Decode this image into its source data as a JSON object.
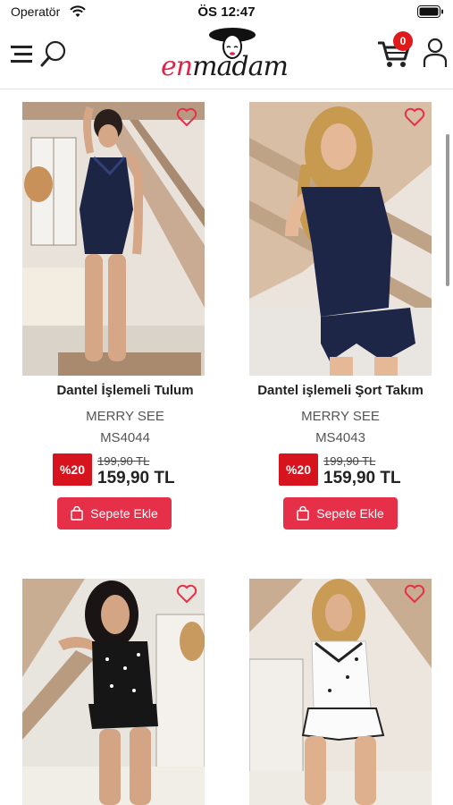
{
  "status_bar": {
    "carrier": "Operatör",
    "time": "ÖS 12:47"
  },
  "header": {
    "logo": "enmadam",
    "cart_count": "0"
  },
  "colors": {
    "accent": "#e6304a",
    "discount": "#d7141d",
    "badge": "#e01a1a"
  },
  "icons": [
    "menu-icon",
    "search-icon",
    "cart-icon",
    "user-icon",
    "heart-icon",
    "bag-icon"
  ],
  "products": [
    {
      "title": "Dantel İşlemeli Tulum",
      "brand": "MERRY SEE",
      "code": "MS4044",
      "discount": "%20",
      "old_price": "199,90 TL",
      "new_price": "159,90 TL",
      "button": "Sepete Ekle"
    },
    {
      "title": "Dantel işlemeli Şort Takım",
      "brand": "MERRY SEE",
      "code": "MS4043",
      "discount": "%20",
      "old_price": "199,90 TL",
      "new_price": "159,90 TL",
      "button": "Sepete Ekle"
    },
    {},
    {}
  ]
}
